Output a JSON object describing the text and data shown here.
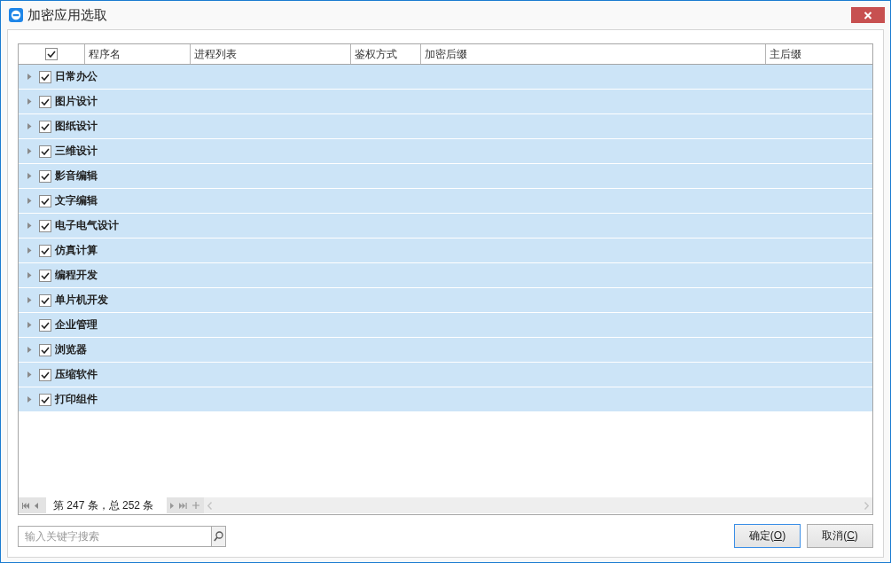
{
  "window": {
    "title": "加密应用选取"
  },
  "table": {
    "all_checked": true,
    "columns": [
      "程序名",
      "进程列表",
      "鉴权方式",
      "加密后缀",
      "主后缀"
    ],
    "groups": [
      {
        "name": "日常办公",
        "checked": true,
        "expanded": false
      },
      {
        "name": "图片设计",
        "checked": true,
        "expanded": false
      },
      {
        "name": "图纸设计",
        "checked": true,
        "expanded": false
      },
      {
        "name": "三维设计",
        "checked": true,
        "expanded": false
      },
      {
        "name": "影音编辑",
        "checked": true,
        "expanded": false
      },
      {
        "name": "文字编辑",
        "checked": true,
        "expanded": false
      },
      {
        "name": "电子电气设计",
        "checked": true,
        "expanded": false
      },
      {
        "name": "仿真计算",
        "checked": true,
        "expanded": false
      },
      {
        "name": "编程开发",
        "checked": true,
        "expanded": false
      },
      {
        "name": "单片机开发",
        "checked": true,
        "expanded": false
      },
      {
        "name": "企业管理",
        "checked": true,
        "expanded": false
      },
      {
        "name": "浏览器",
        "checked": true,
        "expanded": false
      },
      {
        "name": "压缩软件",
        "checked": true,
        "expanded": false
      },
      {
        "name": "打印组件",
        "checked": true,
        "expanded": false
      }
    ]
  },
  "pager": {
    "status": "第 247 条，总 252 条"
  },
  "search": {
    "placeholder": "输入关键字搜索"
  },
  "buttons": [
    {
      "label": "确定(",
      "access_key": "O",
      "label_end": ")",
      "focused": true
    },
    {
      "label": "取消(",
      "access_key": "C",
      "label_end": ")",
      "focused": false
    }
  ]
}
